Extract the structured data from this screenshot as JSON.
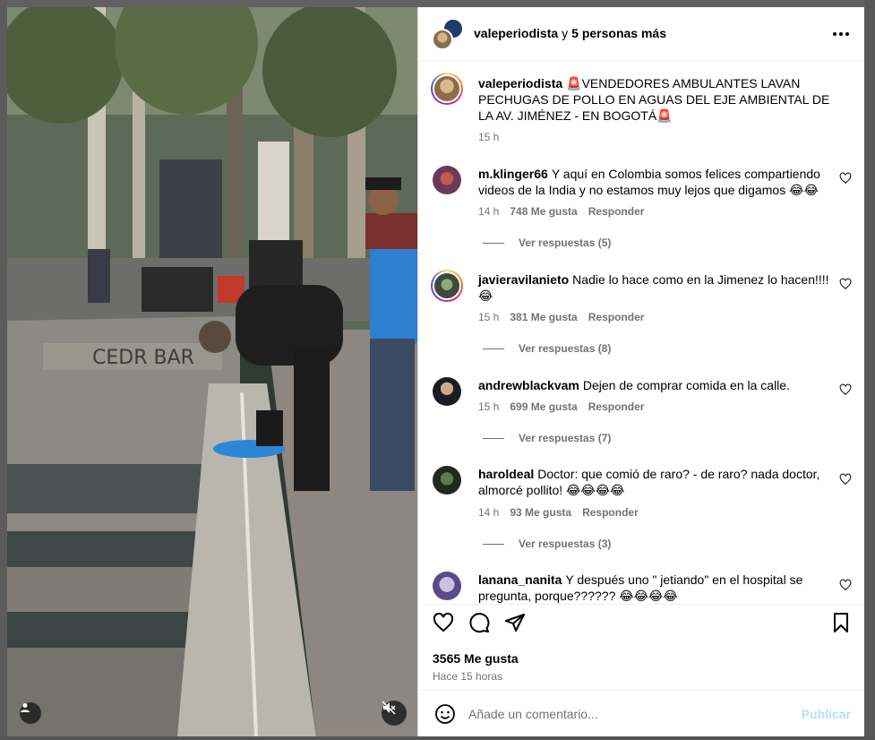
{
  "header": {
    "username": "valeperiodista",
    "connector": "y",
    "others": "5 personas más"
  },
  "caption": {
    "username": "valeperiodista",
    "text": "🚨VENDEDORES AMBULANTES LAVAN PECHUGAS DE POLLO EN AGUAS DEL EJE AMBIENTAL DE LA AV. JIMÉNEZ - EN BOGOTÁ🚨",
    "time": "15 h"
  },
  "comments": [
    {
      "username": "m.klinger66",
      "text": "Y aquí en Colombia somos felices compartiendo videos de la India y no estamos muy lejos que digamos 😂😂",
      "time": "14 h",
      "likes": "748 Me gusta",
      "reply": "Responder",
      "view_replies": "Ver respuestas (5)"
    },
    {
      "username": "javieravilanieto",
      "text": "Nadie lo hace como en la Jimenez lo hacen!!!! 😂",
      "time": "15 h",
      "likes": "381 Me gusta",
      "reply": "Responder",
      "view_replies": "Ver respuestas (8)"
    },
    {
      "username": "andrewblackvam",
      "text": "Dejen de comprar comida en la calle.",
      "time": "15 h",
      "likes": "699 Me gusta",
      "reply": "Responder",
      "view_replies": "Ver respuestas (7)"
    },
    {
      "username": "haroldeal",
      "text": "Doctor: que comió de raro? - de raro? nada doctor, almorcé pollito! 😂😂😂😂",
      "time": "14 h",
      "likes": "93 Me gusta",
      "reply": "Responder",
      "view_replies": "Ver respuestas (3)"
    },
    {
      "username": "lanana_nanita",
      "text": "Y después uno \" jetiando\" en el hospital se pregunta, porque?????? 😂😂😂😂"
    }
  ],
  "actions": {
    "likes_total": "3565 Me gusta",
    "time_ago": "Hace 15 horas"
  },
  "comment_bar": {
    "placeholder": "Añade un comentario...",
    "publish": "Publicar"
  },
  "colors": {
    "publish_disabled": "#b2dffc",
    "secondary_text": "#737373",
    "story_ring": "#d62976"
  },
  "icons": {
    "header_more": "more-horizontal-icon",
    "like": "heart-icon",
    "comment": "comment-icon",
    "share": "send-icon",
    "save": "bookmark-icon",
    "emoji": "emoji-icon",
    "mute": "muted-speaker-icon",
    "tagged": "user-icon"
  }
}
